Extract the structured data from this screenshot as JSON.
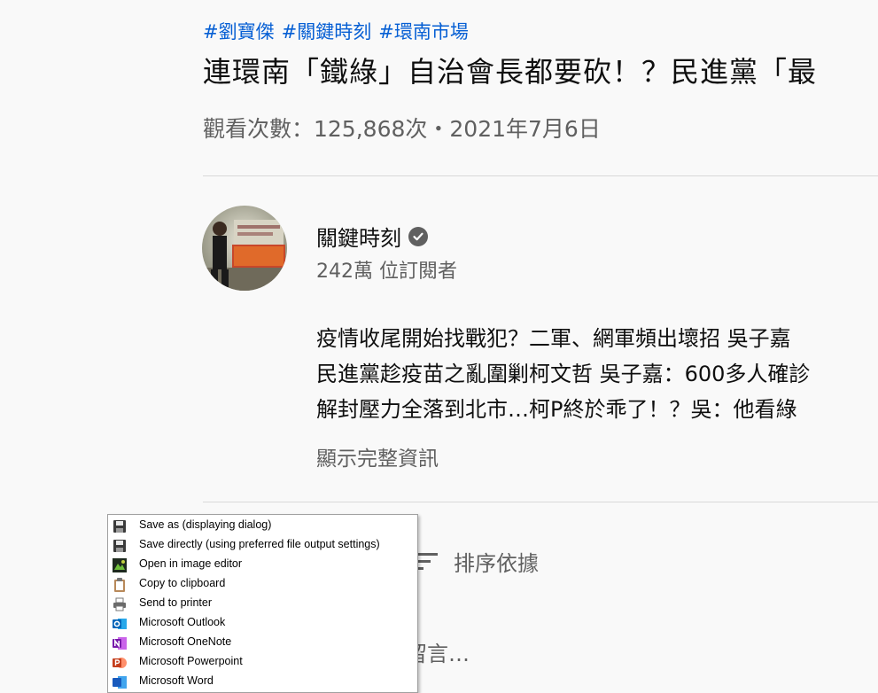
{
  "video": {
    "hashtags": [
      "#劉寶傑",
      "#關鍵時刻",
      "#環南市場"
    ],
    "title": "連環南「鐵綠」自治會長都要砍！？民進黨「最",
    "views_date": "觀看次數：125,868次・2021年7月6日"
  },
  "channel": {
    "name": "關鍵時刻",
    "subscribers": "242萬 位訂閱者",
    "avatar_text": "關鍵時刻"
  },
  "description": {
    "lines": [
      "疫情收尾開始找戰犯？二軍、網軍頻出壞招 吳子嘉",
      "民進黨趁疫苗之亂圍剿柯文哲 吳子嘉：600多人確診",
      "解封壓力全落到北市…柯P終於乖了！？吳：他看綠"
    ],
    "show_more": "顯示完整資訊"
  },
  "comments": {
    "sort_label": "排序依據",
    "placeholder": "留言…"
  },
  "context_menu": {
    "items": [
      {
        "label": "Save as (displaying dialog)",
        "icon": "floppy-icon"
      },
      {
        "label": "Save directly (using preferred file output settings)",
        "icon": "floppy-icon"
      },
      {
        "label": "Open in image editor",
        "icon": "image-editor-icon"
      },
      {
        "label": "Copy to clipboard",
        "icon": "clipboard-icon"
      },
      {
        "label": "Send to printer",
        "icon": "printer-icon"
      },
      {
        "label": "Microsoft Outlook",
        "icon": "outlook-icon"
      },
      {
        "label": "Microsoft OneNote",
        "icon": "onenote-icon"
      },
      {
        "label": "Microsoft Powerpoint",
        "icon": "powerpoint-icon"
      },
      {
        "label": "Microsoft Word",
        "icon": "word-icon"
      }
    ]
  },
  "colors": {
    "link": "#065fd4",
    "secondary_text": "#606060",
    "background": "#f9f9f9"
  }
}
